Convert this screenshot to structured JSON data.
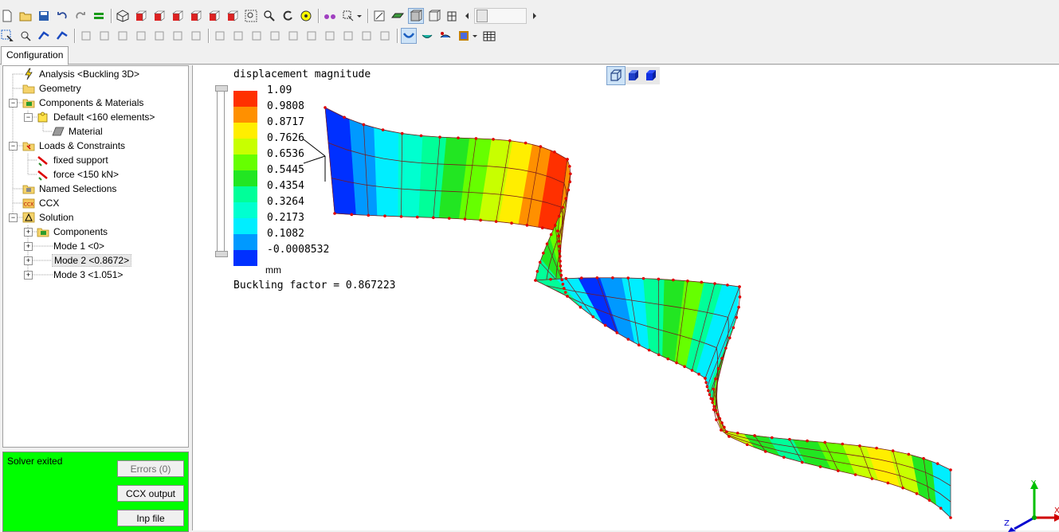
{
  "toolbar": {
    "row1": [
      "new-file-icon",
      "open-folder-icon",
      "save-icon",
      "undo-icon",
      "redo-icon",
      "equals-icon",
      "|",
      "wireframe-cube-icon",
      "view-front-icon",
      "view-back-icon",
      "view-left-icon",
      "view-right-icon",
      "view-top-icon",
      "view-bottom-icon",
      "zoom-box-icon",
      "zoom-icon",
      "rotate-icon",
      "fit-all-icon",
      "|",
      "glasses-icon",
      "select-mode-icon",
      "dropdown-icon",
      "|",
      "sketch-icon",
      "surface-icon",
      "shaded-mode-icon",
      "wireframe-mode-icon",
      "mesh-mode-icon"
    ],
    "row2": [
      "select-arrow-icon",
      "select-node-icon",
      "select-edge-icon",
      "select-face-icon",
      "|",
      "explode-icon",
      "burst-icon",
      "box-icon",
      "cube-outline-icon",
      "close-x-icon",
      "split-icon",
      "align-icon",
      "|",
      "merge-icon",
      "connect-icon",
      "cylinder-icon",
      "arc-icon",
      "spring-icon",
      "branch-icon",
      "points-icon",
      "node-icon",
      "triangle-mesh-icon",
      "triangle-icon",
      "|",
      "deform-icon",
      "result-surface-icon",
      "animate-icon",
      "film-icon",
      "dropdown-icon",
      "table-icon"
    ]
  },
  "tabs": {
    "configuration": "Configuration"
  },
  "tree": {
    "analysis": "Analysis <Buckling 3D>",
    "geometry": "Geometry",
    "components_materials": "Components & Materials",
    "default": "Default <160 elements>",
    "material": "Material",
    "loads": "Loads & Constraints",
    "fixed_support": "fixed support",
    "force": "force <150 kN>",
    "named_selections": "Named Selections",
    "ccx": "CCX",
    "ccx_badge": "CCX",
    "solution": "Solution",
    "components": "Components",
    "mode1": "Mode 1 <0>",
    "mode2": "Mode 2 <0.8672>",
    "mode3": "Mode 3 <1.051>"
  },
  "solver": {
    "status": "Solver exited",
    "errors_label": "Errors (0)",
    "ccx_output_label": "CCX output",
    "inp_file_label": "Inp file",
    "status_color": "#00ff00"
  },
  "viewport": {
    "legend_title": "displacement magnitude",
    "legend_values": [
      "1.09",
      "0.9808",
      "0.8717",
      "0.7626",
      "0.6536",
      "0.5445",
      "0.4354",
      "0.3264",
      "0.2173",
      "0.1082",
      "-0.0008532"
    ],
    "legend_colors": [
      "#ff3000",
      "#ff9000",
      "#ffee00",
      "#c8ff00",
      "#66ff00",
      "#22e622",
      "#00ff99",
      "#00ffd0",
      "#00eeff",
      "#0099ff",
      "#0030ff"
    ],
    "unit": "mm",
    "buckling_label": "Buckling factor = 0.867223",
    "axis_labels": {
      "y": "Y",
      "x": "X",
      "z": "Z"
    }
  }
}
